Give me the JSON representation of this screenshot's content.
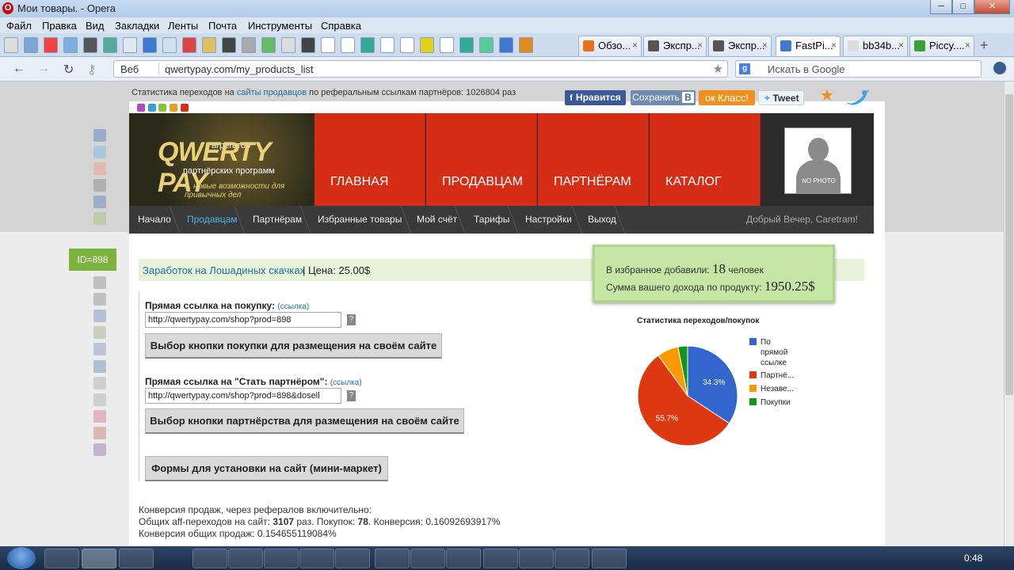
{
  "window": {
    "title": "Мои товары. - Opera",
    "opera_glyph": "O",
    "controls": {
      "minimize": "─",
      "maximize": "□",
      "close": "✕"
    }
  },
  "menubar": [
    "Файл",
    "Правка",
    "Вид",
    "Закладки",
    "Ленты",
    "Почта",
    "Инструменты",
    "Справка"
  ],
  "tabs": [
    {
      "label": "Обзо...",
      "fav_color": "#e8701a"
    },
    {
      "label": "Экспр...",
      "fav_color": "#555555"
    },
    {
      "label": "Экспр...",
      "fav_color": "#555555"
    },
    {
      "label": "FastPi...",
      "fav_color": "#3b7ad0"
    },
    {
      "label": "bb34b...",
      "fav_color": "#dddddd"
    },
    {
      "label": "Piccy....",
      "fav_color": "#3aa035"
    }
  ],
  "tab_close": "×",
  "tab_add": "+",
  "address": {
    "mode": "Веб",
    "url": "qwertypay.com/my_products_list",
    "star": "★",
    "search_placeholder": "Искать в Google",
    "search_engine": "g"
  },
  "page": {
    "stats": {
      "prefix": "Статистика переходов на ",
      "link": "сайты продавцов",
      "suffix": " по реферальным ссылкам партнёров: 1026804 раз"
    },
    "social": {
      "fb": "Нравится",
      "vk": "Сохранить",
      "vk_badge": "В",
      "ok": "Класс!",
      "tw": "Tweet"
    },
    "logo": {
      "brand": "QWERTY PAY",
      "top": "агрегатор",
      "sub": "партнёрских программ",
      "slogan": "... новые возможности для привычных дел"
    },
    "menu": [
      "ГЛАВНАЯ",
      "ПРОДАВЦАМ",
      "ПАРТНЁРАМ",
      "КАТАЛОГ"
    ],
    "avatar_text": "NO PHOTO",
    "nav": {
      "items": [
        "Начало",
        "Продавцам",
        "Партнёрам",
        "Избранные товары",
        "Мой счёт",
        "Тарифы",
        "Настройки",
        "Выход"
      ],
      "active": 1,
      "greeting": "Добрый Вечер, Caretram!"
    },
    "id_tag": "ID=898",
    "product": {
      "name": "Заработок на Лошадиных скачках",
      "price": "| Цена: 25.00$"
    },
    "favorites": {
      "label": "В избранное добавили:",
      "count": "18",
      "suffix": "человек",
      "income_label": "Сумма вашего дохода по продукту:",
      "income": "1950.25$"
    },
    "direct": {
      "label": "Прямая ссылка на покупку:",
      "link_word": "(ссылка)",
      "value": "http://qwertypay.com/shop?prod=898",
      "help": "?",
      "button": "Выбор кнопки покупки для размещения на своём сайте"
    },
    "partner": {
      "label": "Прямая ссылка на \"Стать партнёром\":",
      "link_word": "(ссылка)",
      "value": "http://qwertypay.com/shop?prod=898&dosell",
      "help": "?",
      "button": "Выбор кнопки партнёрства для размещения на своём сайте"
    },
    "forms_button": "Формы для установки на сайт (мини-маркет)",
    "conversion": {
      "l1": "Конверсия продаж, через рефералов включительно:",
      "l2_pre": "Общих aff-переходов на сайт: ",
      "l2_v1": "3107",
      "l2_mid": " раз. Покупок: ",
      "l2_v2": "78",
      "l2_post": ". Конверсия: 0.16092693917%",
      "l3": "Конверсия общих продаж: 0.154655119084%"
    }
  },
  "chart_data": {
    "type": "pie",
    "title": "Статистика переходов/покупок",
    "slices": [
      {
        "name": "По прямой ссылке",
        "legend": "По прямой ссылке",
        "value": 34.3,
        "color": "#3366cc",
        "label": "34.3%"
      },
      {
        "name": "Партнё...",
        "legend": "Партнё...",
        "value": 55.7,
        "color": "#dc3912",
        "label": "55.7%"
      },
      {
        "name": "Незаве...",
        "legend": "Незаве...",
        "value": 6.9,
        "color": "#ff9900",
        "label": ""
      },
      {
        "name": "Покупки",
        "legend": "Покупки",
        "value": 3.1,
        "color": "#109618",
        "label": ""
      }
    ],
    "legend_position": "right"
  },
  "taskbar": {
    "time": "0:48"
  }
}
